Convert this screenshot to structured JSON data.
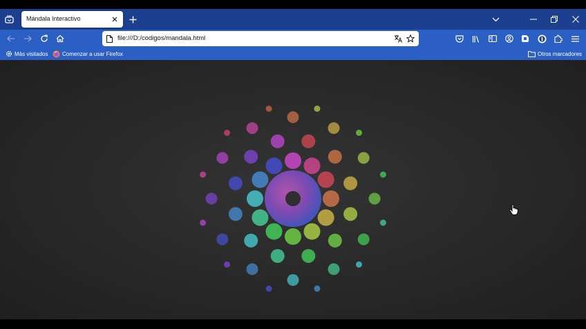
{
  "tab": {
    "title": "Mándala Interactivo"
  },
  "address_bar": {
    "url": "file:///D:/codigos/mandala.html"
  },
  "bookmarks": {
    "most_visited": "Más visitados",
    "getting_started": "Comenzar a usar Firefox",
    "other_bookmarks": "Otros marcadores"
  },
  "colors": {
    "tabstrip": "#1d3f8f",
    "toolbar": "#2b5fc4",
    "page_background": "#2b2b2b"
  },
  "icons": [
    "list-all-tabs-icon",
    "close-icon",
    "plus-icon",
    "chevron-down-icon",
    "minimize-icon",
    "restore-icon",
    "window-close-icon",
    "back-arrow-icon",
    "forward-arrow-icon",
    "reload-icon",
    "home-icon",
    "page-icon",
    "translate-icon",
    "star-icon",
    "pocket-icon",
    "library-icon",
    "sidebar-icon",
    "account-icon",
    "extension-icon",
    "puzzle-icon",
    "menu-icon",
    "gear-icon",
    "firefox-icon",
    "folder-icon",
    "hand-cursor-icon"
  ]
}
